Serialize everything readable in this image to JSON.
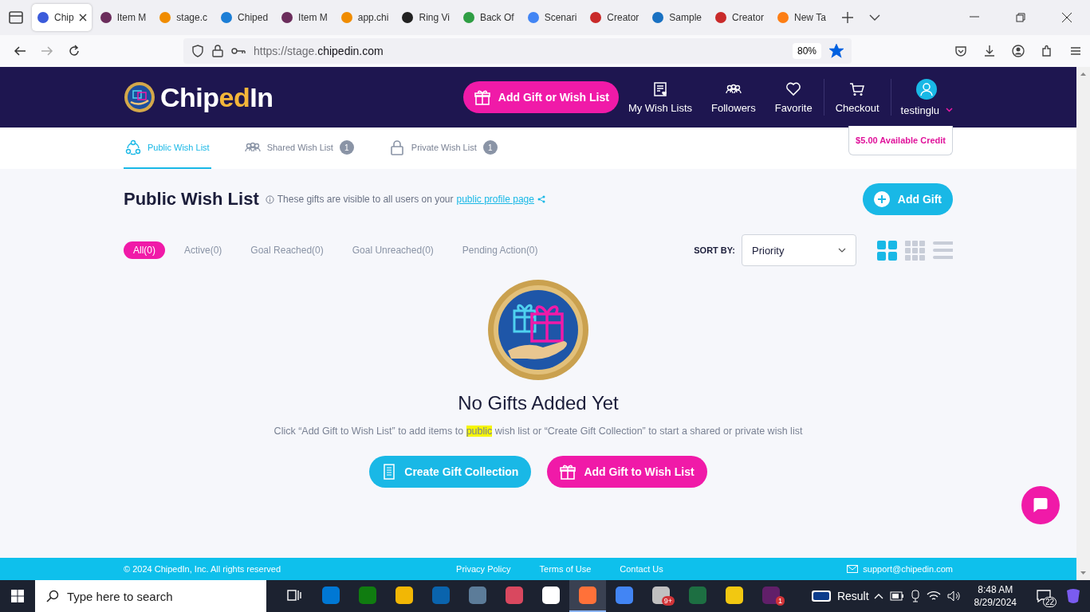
{
  "browser": {
    "tabs": [
      {
        "title": "Chip",
        "selected": true,
        "color": "#3b5bdb"
      },
      {
        "title": "Item M",
        "selected": false,
        "color": "#6b2d5c"
      },
      {
        "title": "stage.c",
        "selected": false,
        "color": "#f08c00"
      },
      {
        "title": "Chiped",
        "selected": false,
        "color": "#1c7ed6"
      },
      {
        "title": "Item M",
        "selected": false,
        "color": "#6b2d5c"
      },
      {
        "title": "app.chi",
        "selected": false,
        "color": "#f08c00"
      },
      {
        "title": "Ring Vi",
        "selected": false,
        "color": "#222222"
      },
      {
        "title": "Back Of",
        "selected": false,
        "color": "#2f9e44"
      },
      {
        "title": "Scenari",
        "selected": false,
        "color": "#4285f4"
      },
      {
        "title": "Creator",
        "selected": false,
        "color": "#c92a2a"
      },
      {
        "title": "Sample",
        "selected": false,
        "color": "#1971c2"
      },
      {
        "title": "Creator",
        "selected": false,
        "color": "#c92a2a"
      },
      {
        "title": "New Ta",
        "selected": false,
        "color": "#fd7e14"
      }
    ],
    "url": {
      "prefix": "https://stage.",
      "domain": "chipedin.com"
    },
    "zoom": "80%",
    "bookmarked": true
  },
  "site": {
    "logo": {
      "lead": "Chip",
      "accent": "ed",
      "tail": "In"
    },
    "primary_button": "Add Gift or Wish List",
    "nav": [
      {
        "label": "My Wish Lists",
        "kind": "list"
      },
      {
        "label": "Followers",
        "kind": "people"
      },
      {
        "label": "Favorite",
        "kind": "heart"
      },
      {
        "label": "Checkout",
        "kind": "cart"
      }
    ],
    "user": "testinglu",
    "credit": "$5.00 Available Credit"
  },
  "list_tabs": [
    {
      "label": "Public Wish List",
      "kind": "public",
      "selected": true
    },
    {
      "label": "Shared Wish List",
      "kind": "shared",
      "count": "1",
      "selected": false
    },
    {
      "label": "Private Wish List",
      "kind": "private",
      "count": "1",
      "selected": false
    }
  ],
  "heading": {
    "title": "Public Wish List",
    "note": "These gifts are visible to all users on your",
    "link": "public profile page",
    "add_button": "Add Gift"
  },
  "filters": [
    {
      "label": "All(0)",
      "selected": true
    },
    {
      "label": "Active(0)",
      "selected": false
    },
    {
      "label": "Goal Reached(0)",
      "selected": false
    },
    {
      "label": "Goal Unreached(0)",
      "selected": false
    },
    {
      "label": "Pending Action(0)",
      "selected": false
    }
  ],
  "sort": {
    "label": "SORT BY:",
    "value": "Priority"
  },
  "views": [
    {
      "kind": "large-grid",
      "selected": true
    },
    {
      "kind": "small-grid",
      "selected": false
    },
    {
      "kind": "list",
      "selected": false
    }
  ],
  "empty": {
    "title": "No Gifts Added Yet",
    "message": {
      "before": "Click “Add Gift to Wish List” to add items to",
      "highlight": "public",
      "after": "wish list or “Create Gift Collection” to start a shared or private wish list"
    },
    "buttons": [
      {
        "label": "Create Gift Collection",
        "kind": "collection"
      },
      {
        "label": "Add Gift to Wish List",
        "kind": "gift"
      }
    ]
  },
  "footer": {
    "copyright": "© 2024 ChipedIn, Inc. All rights reserved",
    "links": [
      "Privacy Policy",
      "Terms of Use",
      "Contact Us"
    ],
    "email": "support@chipedin.com"
  },
  "taskbar": {
    "search_placeholder": "Type here to search",
    "apps": [
      {
        "color": "#0078d4",
        "active": false
      },
      {
        "color": "#107c10",
        "active": false
      },
      {
        "color": "#f2b705",
        "active": false
      },
      {
        "color": "#0a64ad",
        "active": false
      },
      {
        "color": "#5c7c99",
        "active": false
      },
      {
        "color": "#d9485f",
        "active": false
      },
      {
        "color": "#ffffff",
        "active": false
      },
      {
        "color": "#ff7139",
        "active": true
      },
      {
        "color": "#4285f4",
        "active": false
      },
      {
        "color": "#c0c0c0",
        "active": false,
        "badge": "9+"
      },
      {
        "color": "#1d6f42",
        "active": false
      },
      {
        "color": "#f2c811",
        "active": false
      },
      {
        "color": "#611f69",
        "active": false,
        "badge": "1"
      }
    ],
    "weather": "Result",
    "time": "8:48 AM",
    "date": "8/29/2024",
    "notifications": "22"
  }
}
